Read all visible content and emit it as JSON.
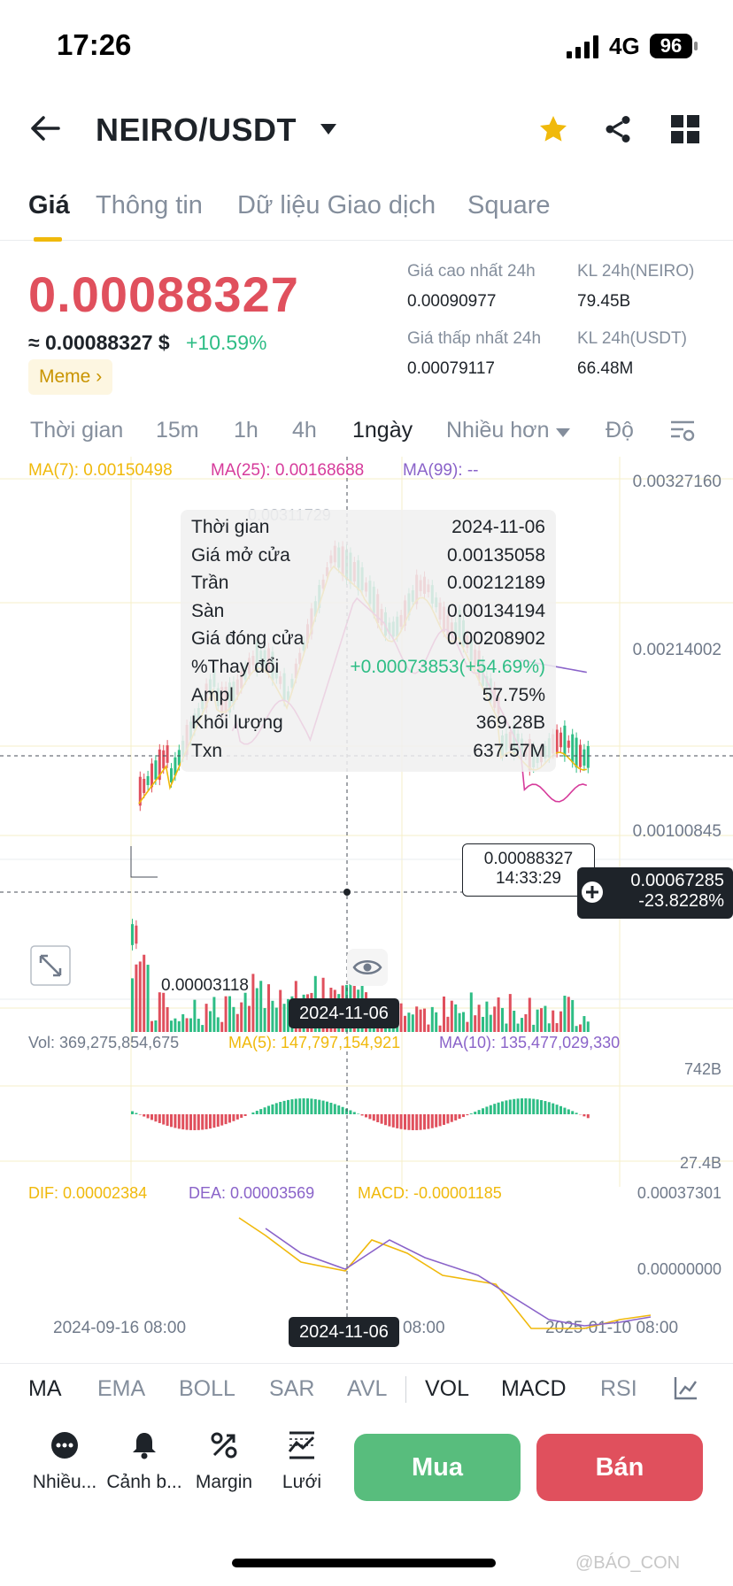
{
  "status": {
    "time": "17:26",
    "network": "4G",
    "battery": "96"
  },
  "header": {
    "pair": "NEIRO/USDT"
  },
  "tabs": [
    "Giá",
    "Thông tin",
    "Dữ liệu Giao dịch",
    "Square"
  ],
  "price": {
    "last": "0.00088327",
    "usd": "≈ 0.00088327 $",
    "change": "+10.59%",
    "tag": "Meme"
  },
  "stats": {
    "high_label": "Giá cao nhất 24h",
    "high": "0.00090977",
    "low_label": "Giá thấp nhất 24h",
    "low": "0.00079117",
    "vol_base_label": "KL 24h(NEIRO)",
    "vol_base": "79.45B",
    "vol_quote_label": "KL 24h(USDT)",
    "vol_quote": "66.48M"
  },
  "timeframes": [
    "Thời gian",
    "15m",
    "1h",
    "4h",
    "1ngày",
    "Nhiều hơn",
    "Độ"
  ],
  "chart_labels": {
    "ma7": "MA(7): 0.00150498",
    "ma25": "MA(25): 0.00168688",
    "ma99": "MA(99): --",
    "axis_top": "0.00327160",
    "axis_mid": "0.00214002",
    "axis_low": "0.00100845",
    "peak": "0.00311729",
    "trough": "0.00003118",
    "last_price_tag": "0.00088327",
    "last_price_time": "14:33:29",
    "cross_price": "0.00067285",
    "cross_pct": "-23.8228%",
    "vol": "Vol: 369,275,854,675",
    "vol_ma5": "MA(5): 147,797,154,921",
    "vol_ma10": "MA(10): 135,477,029,330",
    "vol_axis_top": "742B",
    "vol_axis_bottom": "27.4B",
    "dif": "DIF: 0.00002384",
    "dea": "DEA: 0.00003569",
    "macd": "MACD: -0.00001185",
    "macd_axis_top": "0.00037301",
    "macd_axis_zero": "0.00000000",
    "date_left": "2024-09-16 08:00",
    "date_mid_partial": "08:00",
    "date_right": "2025-01-10 08:00",
    "crosshair_date": "2024-11-06"
  },
  "tooltip": [
    {
      "k": "Thời gian",
      "v": "2024-11-06"
    },
    {
      "k": "Giá mở cửa",
      "v": "0.00135058"
    },
    {
      "k": "Trần",
      "v": "0.00212189"
    },
    {
      "k": "Sàn",
      "v": "0.00134194"
    },
    {
      "k": "Giá đóng cửa",
      "v": "0.00208902"
    },
    {
      "k": "%Thay đổi",
      "v": "+0.00073853(+54.69%)"
    },
    {
      "k": "Ampl",
      "v": "57.75%"
    },
    {
      "k": "Khối lượng",
      "v": "369.28B"
    },
    {
      "k": "Txn",
      "v": "637.57M"
    }
  ],
  "indicators": [
    "MA",
    "EMA",
    "BOLL",
    "SAR",
    "AVL",
    "VOL",
    "MACD",
    "RSI"
  ],
  "actions": [
    "Nhiều...",
    "Cảnh b...",
    "Margin",
    "Lưới"
  ],
  "buy": "Mua",
  "sell": "Bán",
  "watermark": "@BÁO_CON",
  "colors": {
    "up": "#2ebd85",
    "down": "#e0505d",
    "accent": "#f0b90b",
    "ma7": "#f0b90b",
    "ma25": "#d63b9b",
    "ma99": "#8a63c9"
  }
}
